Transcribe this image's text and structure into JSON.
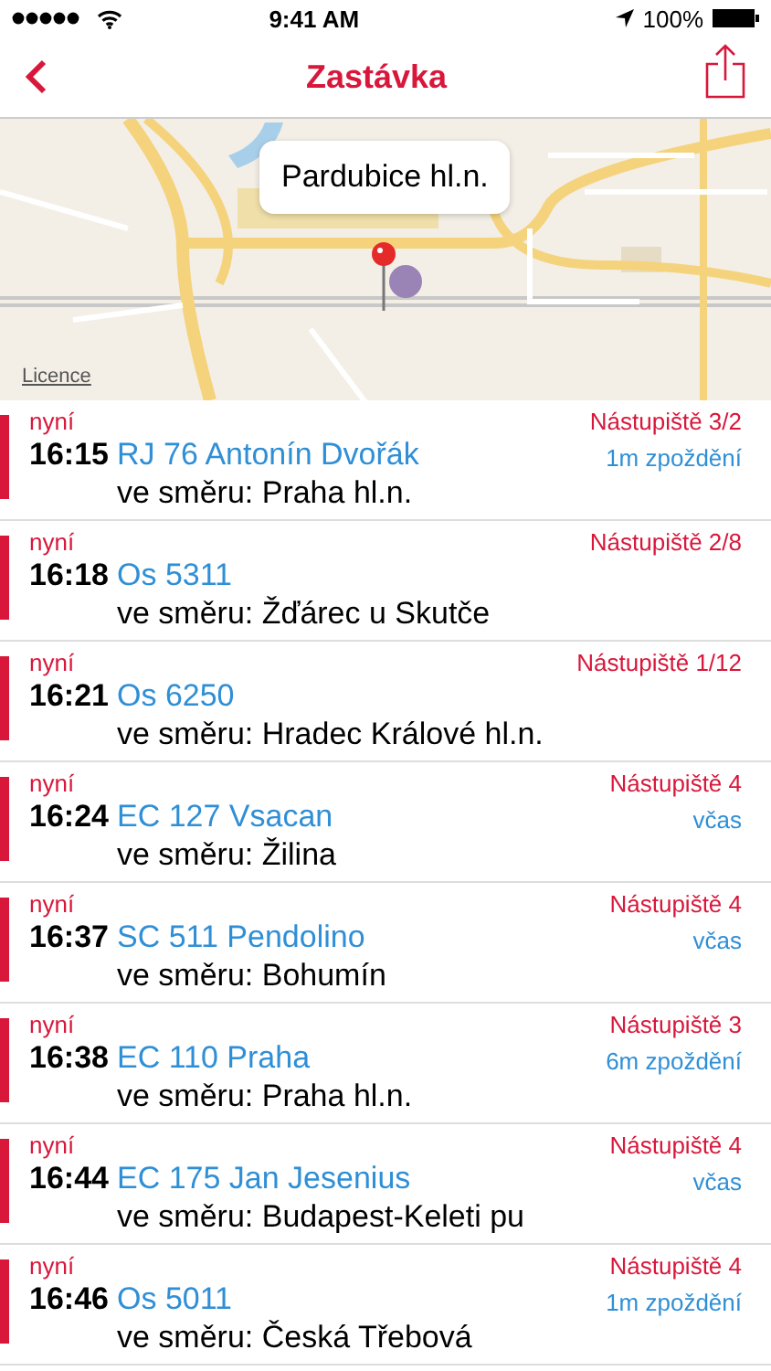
{
  "status_bar": {
    "time": "9:41 AM",
    "battery": "100%"
  },
  "nav": {
    "title": "Zastávka"
  },
  "map": {
    "callout": "Pardubice hl.n.",
    "legal_link": "Licence"
  },
  "departures": [
    {
      "when": "nyní",
      "time": "16:15",
      "train": "RJ 76 Antonín Dvořák",
      "direction": "ve směru: Praha hl.n.",
      "platform": "Nástupiště 3/2",
      "status": "1m zpoždění"
    },
    {
      "when": "nyní",
      "time": "16:18",
      "train": "Os 5311",
      "direction": "ve směru: Žďárec u Skutče",
      "platform": "Nástupiště 2/8"
    },
    {
      "when": "nyní",
      "time": "16:21",
      "train": "Os 6250",
      "direction": "ve směru: Hradec Králové hl.n.",
      "platform": "Nástupiště 1/12"
    },
    {
      "when": "nyní",
      "time": "16:24",
      "train": "EC 127 Vsacan",
      "direction": "ve směru: Žilina",
      "platform": "Nástupiště 4",
      "status": "včas"
    },
    {
      "when": "nyní",
      "time": "16:37",
      "train": "SC 511 Pendolino",
      "direction": "ve směru: Bohumín",
      "platform": "Nástupiště 4",
      "status": "včas"
    },
    {
      "when": "nyní",
      "time": "16:38",
      "train": "EC 110 Praha",
      "direction": "ve směru: Praha hl.n.",
      "platform": "Nástupiště 3",
      "status": "6m zpoždění"
    },
    {
      "when": "nyní",
      "time": "16:44",
      "train": "EC 175 Jan Jesenius",
      "direction": "ve směru: Budapest-Keleti pu",
      "platform": "Nástupiště 4",
      "status": "včas"
    },
    {
      "when": "nyní",
      "time": "16:46",
      "train": "Os 5011",
      "direction": "ve směru: Česká Třebová",
      "platform": "Nástupiště 4",
      "status": "1m zpoždění"
    }
  ]
}
